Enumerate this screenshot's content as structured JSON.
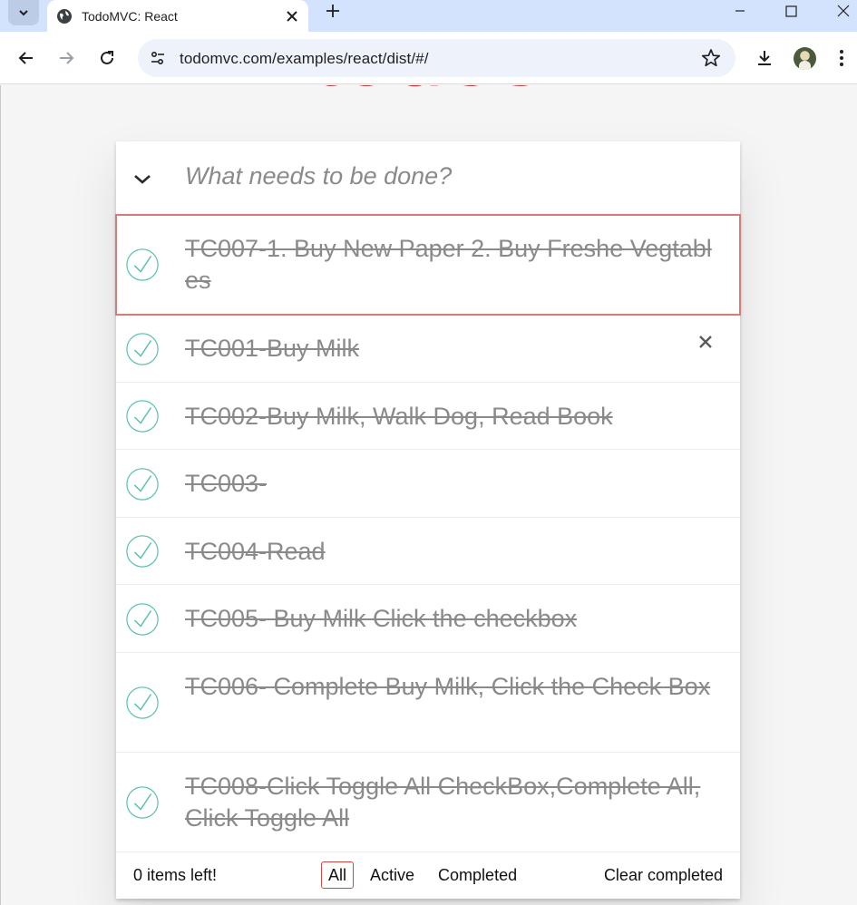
{
  "browser": {
    "tab_title": "TodoMVC: React",
    "url": "todomvc.com/examples/react/dist/#/"
  },
  "page": {
    "logo": "todos",
    "new_todo_placeholder": "What needs to be done?",
    "todos": [
      {
        "text": "TC007-1. Buy New Paper 2. Buy Freshe Vegtables",
        "completed": true
      },
      {
        "text": "TC001-Buy Milk",
        "completed": true
      },
      {
        "text": "TC002-Buy Milk, Walk Dog, Read Book",
        "completed": true
      },
      {
        "text": "TC003-",
        "completed": true
      },
      {
        "text": "TC004-Read",
        "completed": true
      },
      {
        "text": "TC005- Buy Milk Click the checkbox",
        "completed": true
      },
      {
        "text": "TC006- Complete Buy Milk, Click the Check Box",
        "completed": true
      },
      {
        "text": "TC008-Click Toggle All CheckBox,Complete All, Click Toggle All",
        "completed": true
      }
    ],
    "footer": {
      "count": "0 items left!",
      "filters": [
        "All",
        "Active",
        "Completed"
      ],
      "selected_filter": "All",
      "clear": "Clear completed"
    }
  },
  "colors": {
    "accent": "#b83f45",
    "check": "#5dc2af",
    "completed_text": "#8a8a8a"
  }
}
